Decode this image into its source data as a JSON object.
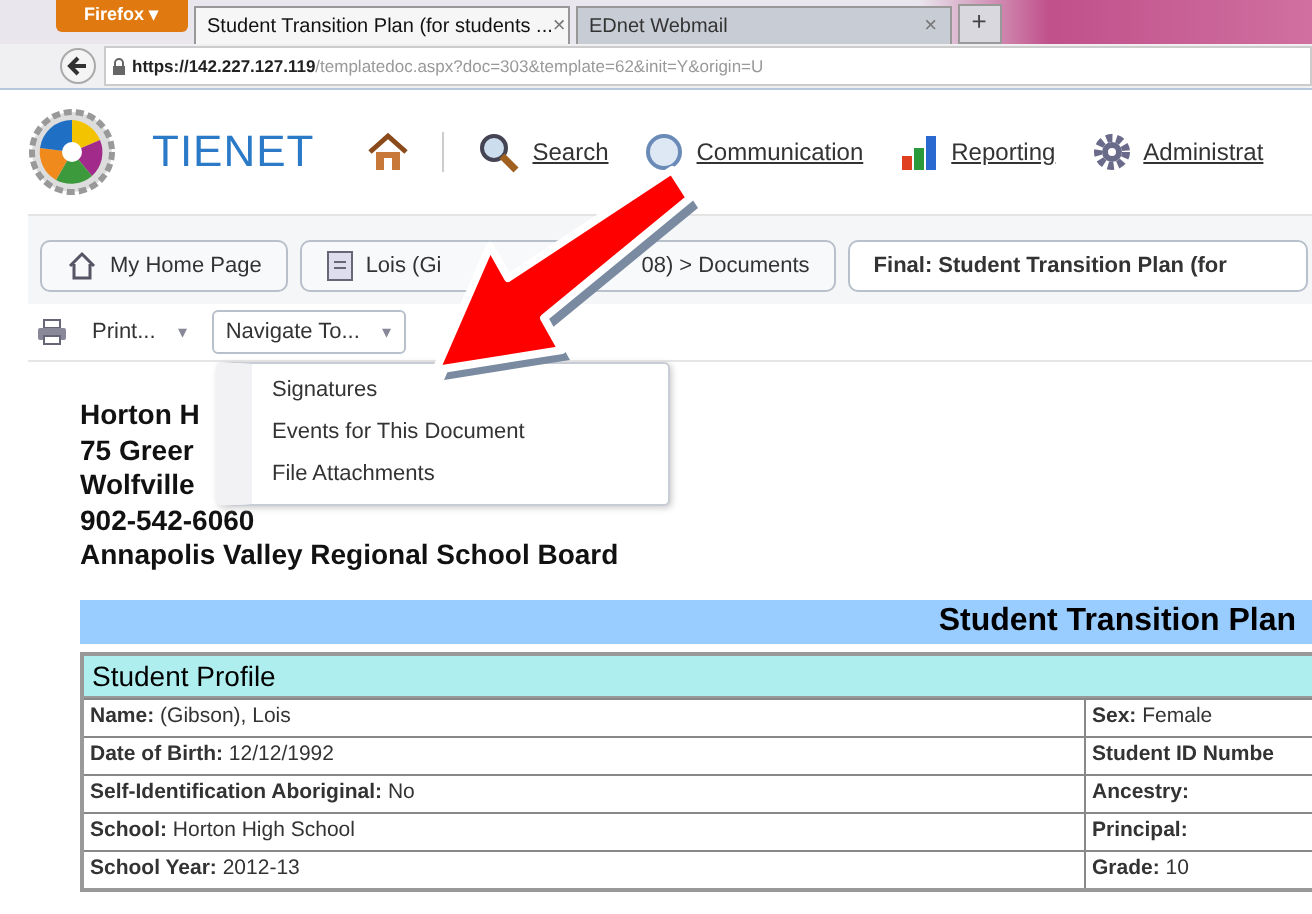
{
  "browser": {
    "menu_button": "Firefox ▾",
    "tabs": [
      {
        "label": "Student Transition Plan (for students ...",
        "selected": true,
        "close": "×"
      },
      {
        "label": "EDnet Webmail",
        "selected": false,
        "close": "×"
      }
    ],
    "new_tab": "+",
    "address": {
      "host": "https://142.227.127.119",
      "path": "/templatedoc.aspx?doc=303&template=62&init=Y&origin=U"
    }
  },
  "header": {
    "logo_text": "TIENET",
    "nav": [
      {
        "label": "Search",
        "kind": "search"
      },
      {
        "label": "Communication",
        "kind": "communication"
      },
      {
        "label": "Reporting",
        "kind": "reporting"
      },
      {
        "label": "Administrat",
        "kind": "admin"
      }
    ]
  },
  "breadcrumbs": [
    {
      "parts": [
        "My Home Page"
      ],
      "kind": "home",
      "current": false
    },
    {
      "parts": [
        "Lois (Gi",
        "08) > Documents"
      ],
      "kind": "doc",
      "current": false
    },
    {
      "parts": [
        "Final: Student Transition Plan (for"
      ],
      "kind": "none",
      "current": true
    }
  ],
  "toolbar": {
    "print": "Print...",
    "print_caret": "▾",
    "navigate": "Navigate To...",
    "navigate_caret": "▾",
    "menu": [
      "Signatures",
      "Events for This Document",
      "File Attachments"
    ]
  },
  "address_lines": [
    "Horton H",
    "75 Greer",
    "Wolfville",
    "902-542-6060",
    "Annapolis Valley Regional School Board"
  ],
  "plan_title": "Student Transition Plan",
  "section": "Student Profile",
  "rows": [
    {
      "left_label": "Name:",
      "left_value": "(Gibson), Lois",
      "right_label": "Sex:",
      "right_value": "Female"
    },
    {
      "left_label": "Date of Birth:",
      "left_value": "12/12/1992",
      "right_label": "Student ID Numbe",
      "right_value": ""
    },
    {
      "left_label": "Self-Identification Aboriginal:",
      "left_value": "No",
      "right_label": "Ancestry:",
      "right_value": ""
    },
    {
      "left_label": "School:",
      "left_value": "Horton High School",
      "right_label": "Principal:",
      "right_value": ""
    },
    {
      "left_label": "School Year:",
      "left_value": "2012-13",
      "right_label": "Grade:",
      "right_value": "10"
    }
  ]
}
